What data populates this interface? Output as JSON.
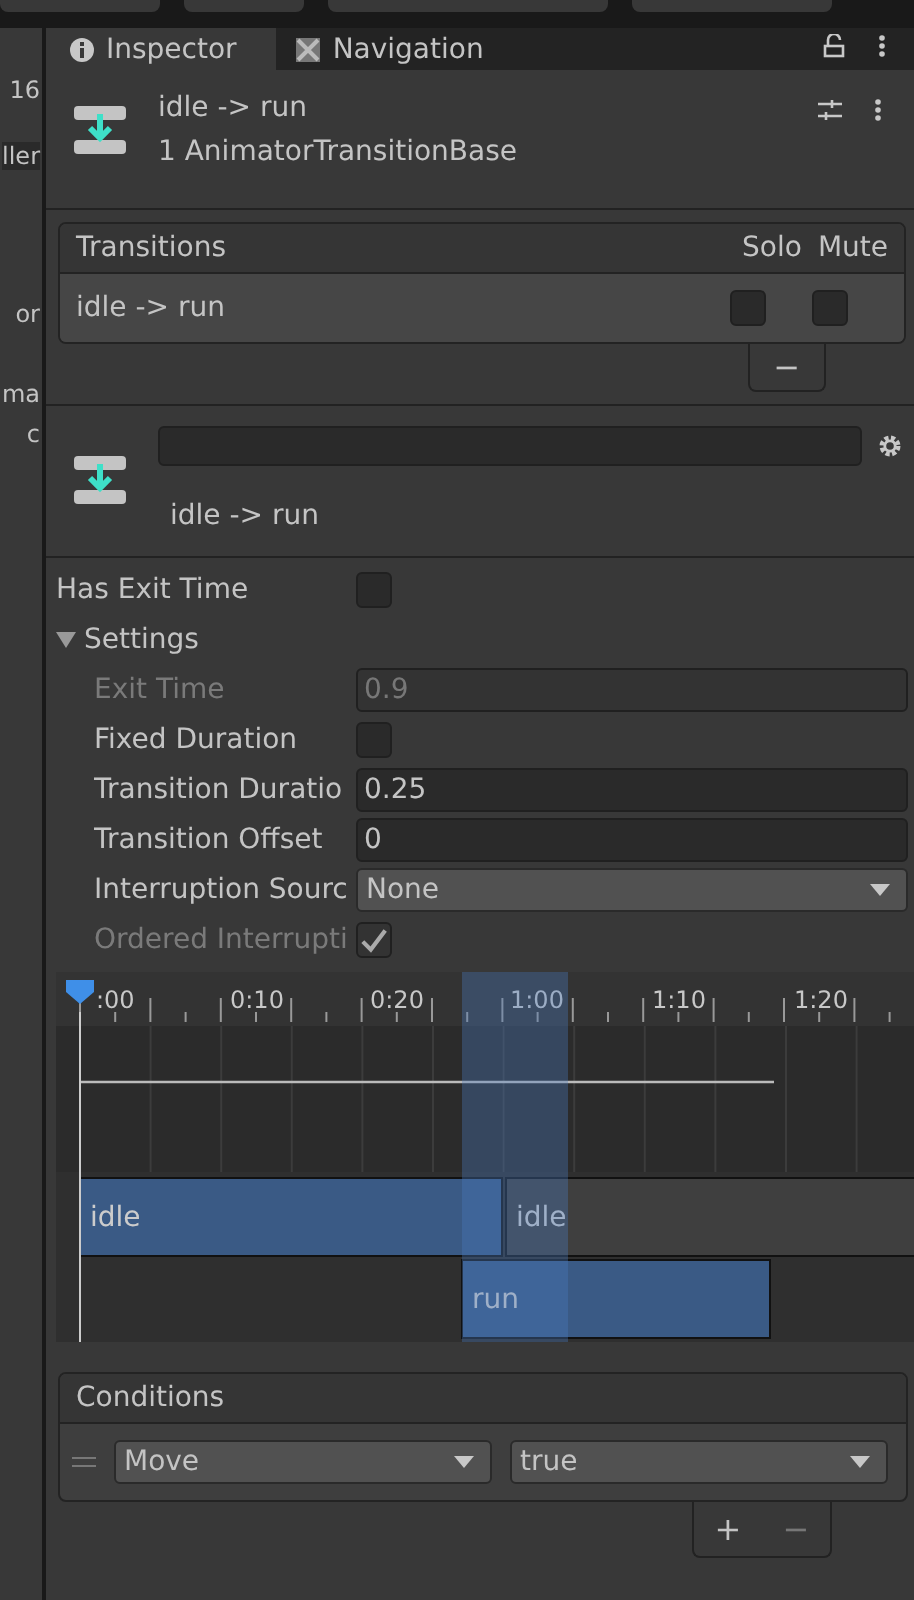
{
  "left_strip": [
    "16",
    "ller",
    "or",
    "ma",
    "c"
  ],
  "tabs": [
    {
      "label": "Inspector",
      "selected": true,
      "kind": "info"
    },
    {
      "label": "Navigation",
      "selected": false,
      "kind": "nav"
    }
  ],
  "header": {
    "title": "idle -> run",
    "subtitle": "1 AnimatorTransitionBase"
  },
  "transitions": {
    "title": "Transitions",
    "columns": [
      "Solo",
      "Mute"
    ],
    "rows": [
      {
        "name": "idle -> run",
        "solo": false,
        "mute": false,
        "selected": true
      }
    ],
    "remove": "−"
  },
  "transition": {
    "name": "idle -> run"
  },
  "has_exit_time": {
    "label": "Has Exit Time",
    "checked": false
  },
  "settings": {
    "label": "Settings",
    "expanded": true,
    "fields": [
      {
        "kind": "number",
        "label": "Exit Time",
        "value": "0.9",
        "disabled": true
      },
      {
        "kind": "check",
        "label": "Fixed Duration",
        "checked": false,
        "disabled": false
      },
      {
        "kind": "number",
        "label": "Transition Duratio",
        "value": "0.25",
        "disabled": false
      },
      {
        "kind": "number",
        "label": "Transition Offset",
        "value": "0",
        "disabled": false
      },
      {
        "kind": "dropdown",
        "label": "Interruption Sourc",
        "value": "None",
        "disabled": false
      },
      {
        "kind": "check",
        "label": "Ordered Interrupti",
        "checked": true,
        "disabled": true
      }
    ]
  },
  "timeline": {
    "ticks": [
      ":00",
      "0:10",
      "0:20",
      "1:00",
      "1:10",
      "1:20"
    ],
    "tracks": [
      {
        "label": "idle"
      },
      {
        "label": "idle"
      },
      {
        "label": "run"
      }
    ]
  },
  "conditions": {
    "title": "Conditions",
    "items": [
      {
        "parameter": "Move",
        "value": "true"
      }
    ],
    "add": "+",
    "remove": "−"
  }
}
